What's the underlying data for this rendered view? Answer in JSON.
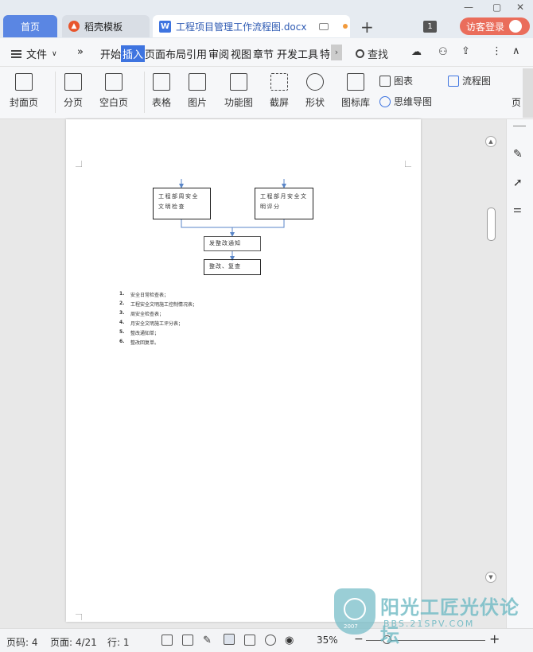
{
  "tabs": {
    "home": "首页",
    "straw": "稻壳模板",
    "doc": "工程项目管理工作流程图.docx"
  },
  "titlebar": {
    "count": "1",
    "login": "访客登录"
  },
  "menu": {
    "file": "文件",
    "more": "»",
    "items": [
      "开始",
      "插入",
      "页面布局",
      "引用",
      "审阅",
      "视图",
      "章节",
      "开发工具",
      "特"
    ],
    "search": "查找"
  },
  "ribbon": {
    "cover": "封面页",
    "pagebreak": "分页",
    "blankpage": "空白页",
    "table": "表格",
    "picture": "图片",
    "function": "功能图",
    "screenshot": "截屏",
    "shape": "形状",
    "iconlib": "图标库",
    "chart": "图表",
    "flowchart": "流程图",
    "mindmap": "思维导图",
    "more": "页"
  },
  "document": {
    "box1": "工程部周安全文明检查",
    "box2": "工程部月安全文明评分",
    "box3": "发整改通知",
    "box4": "整改、复查",
    "list": [
      {
        "num": "1.",
        "text": "安全日常检查表；"
      },
      {
        "num": "2.",
        "text": "工程安全文明施工控制情况表；"
      },
      {
        "num": "3.",
        "text": "周安全检查表；"
      },
      {
        "num": "4.",
        "text": "月安全文明施工评分表；"
      },
      {
        "num": "5.",
        "text": "整改通知单；"
      },
      {
        "num": "6.",
        "text": "整改回复单。"
      }
    ]
  },
  "status": {
    "page_no": "页码: 4",
    "pages": "页面: 4/21",
    "line": "行: 1",
    "zoom": "35%"
  },
  "watermark": {
    "brand": "阳光工匠光伏论坛",
    "url": "BBS.21SPV.COM",
    "year": "2007"
  }
}
